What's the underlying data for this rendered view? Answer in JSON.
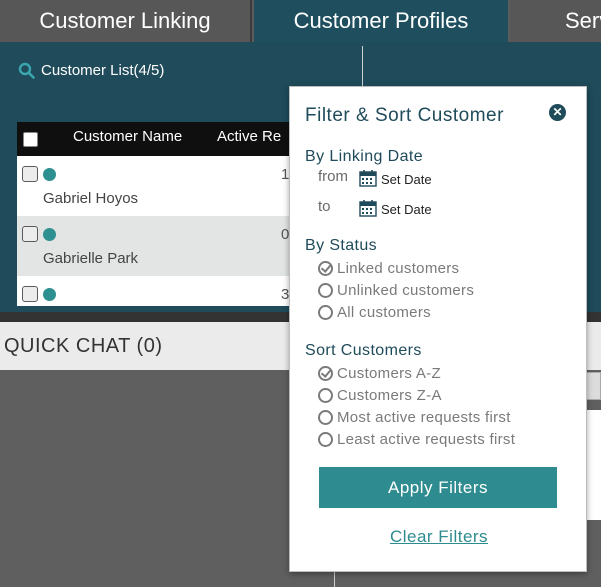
{
  "tabs": [
    {
      "label": "Customer Linking"
    },
    {
      "label": "Customer Profiles"
    },
    {
      "label": "Serv"
    }
  ],
  "customer_list": {
    "label": "Customer List(4/5)"
  },
  "table": {
    "headers": {
      "name": "Customer Name",
      "active": "Active Re"
    },
    "rows": [
      {
        "name": "Gabriel Hoyos",
        "count": "1"
      },
      {
        "name": "Gabrielle Park",
        "count": "0"
      },
      {
        "name": "",
        "count": "3"
      }
    ]
  },
  "quick_chat": {
    "label": "QUICK CHAT (0)"
  },
  "filter": {
    "title": "Filter & Sort Customer",
    "close_icon": "close-icon",
    "linking_date": {
      "title": "By Linking Date",
      "from_label": "from",
      "to_label": "to",
      "from_value": "Set Date",
      "to_value": "Set Date"
    },
    "status": {
      "title": "By Status",
      "options": [
        {
          "label": "Linked customers",
          "checked": true
        },
        {
          "label": "Unlinked customers",
          "checked": false
        },
        {
          "label": "All customers",
          "checked": false
        }
      ]
    },
    "sort": {
      "title": "Sort Customers",
      "options": [
        {
          "label": "Customers A-Z",
          "checked": true
        },
        {
          "label": "Customers Z-A",
          "checked": false
        },
        {
          "label": "Most active requests first",
          "checked": false
        },
        {
          "label": "Least active requests first",
          "checked": false
        }
      ]
    },
    "apply_label": "Apply Filters",
    "clear_label": "Clear Filters"
  },
  "colors": {
    "teal_dark": "#1f4b5a",
    "teal_accent": "#2e8b8f",
    "tab_gray": "#575757"
  }
}
